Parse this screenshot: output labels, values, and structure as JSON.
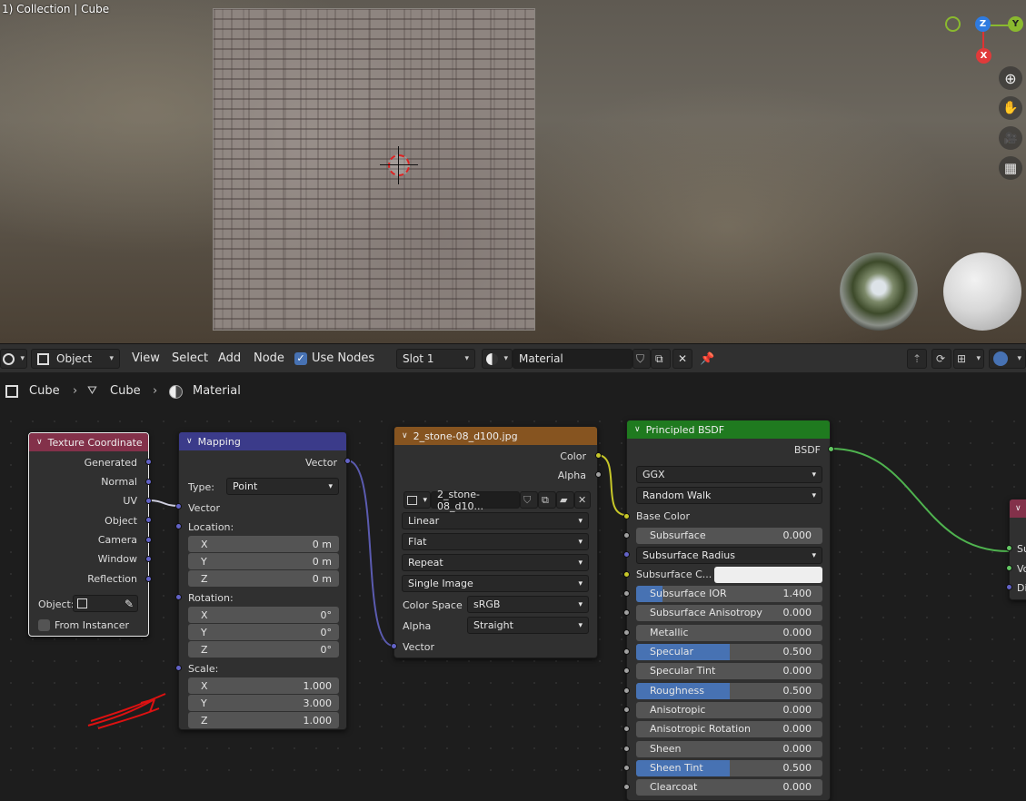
{
  "viewport": {
    "title": "1) Collection | Cube",
    "gizmo": {
      "z": "Z",
      "y": "Y",
      "x": "X"
    },
    "tools": [
      {
        "icon": "zoom-icon",
        "glyph": "⊕"
      },
      {
        "icon": "hand-pan-icon",
        "glyph": "✋"
      },
      {
        "icon": "camera-icon",
        "glyph": "🎥"
      },
      {
        "icon": "grid-perspective-icon",
        "glyph": "▦"
      }
    ]
  },
  "header": {
    "mode": "Object",
    "menus": [
      "View",
      "Select",
      "Add",
      "Node"
    ],
    "use_nodes": "Use Nodes",
    "slot": "Slot 1",
    "material": "Material"
  },
  "breadcrumb": [
    "Cube",
    "Cube",
    "Material"
  ],
  "nodes": {
    "texcoord": {
      "title": "Texture Coordinate",
      "outputs": [
        "Generated",
        "Normal",
        "UV",
        "Object",
        "Camera",
        "Window",
        "Reflection"
      ],
      "object_label": "Object:",
      "from_instancer": "From Instancer"
    },
    "mapping": {
      "title": "Mapping",
      "output": "Vector",
      "type_label": "Type:",
      "type_value": "Point",
      "input_vector": "Vector",
      "location": {
        "label": "Location:",
        "x": "0 m",
        "y": "0 m",
        "z": "0 m"
      },
      "rotation": {
        "label": "Rotation:",
        "x": "0°",
        "y": "0°",
        "z": "0°"
      },
      "scale": {
        "label": "Scale:",
        "x": "1.000",
        "y": "3.000",
        "z": "1.000"
      },
      "axis": [
        "X",
        "Y",
        "Z"
      ]
    },
    "image": {
      "title": "2_stone-08_d100.jpg",
      "outputs": [
        "Color",
        "Alpha"
      ],
      "file": "2_stone-08_d10...",
      "interpolation": "Linear",
      "projection": "Flat",
      "extension": "Repeat",
      "source": "Single Image",
      "colorspace_label": "Color Space",
      "colorspace": "sRGB",
      "alpha_label": "Alpha",
      "alpha": "Straight",
      "input": "Vector"
    },
    "bsdf": {
      "title": "Principled BSDF",
      "output": "BSDF",
      "distribution": "GGX",
      "subsurface_method": "Random Walk",
      "base_color": "Base Color",
      "subsurface_color": "Subsurface C...",
      "subsurface_radius": "Subsurface Radius",
      "sliders": [
        {
          "label": "Subsurface",
          "value": "0.000",
          "fill": 0
        },
        {
          "label": "Subsurface IOR",
          "value": "1.400",
          "fill": 0.14
        },
        {
          "label": "Subsurface Anisotropy",
          "value": "0.000",
          "fill": 0
        },
        {
          "label": "Metallic",
          "value": "0.000",
          "fill": 0
        },
        {
          "label": "Specular",
          "value": "0.500",
          "fill": 0.5
        },
        {
          "label": "Specular Tint",
          "value": "0.000",
          "fill": 0
        },
        {
          "label": "Roughness",
          "value": "0.500",
          "fill": 0.5
        },
        {
          "label": "Anisotropic",
          "value": "0.000",
          "fill": 0
        },
        {
          "label": "Anisotropic Rotation",
          "value": "0.000",
          "fill": 0
        },
        {
          "label": "Sheen",
          "value": "0.000",
          "fill": 0
        },
        {
          "label": "Sheen Tint",
          "value": "0.500",
          "fill": 0.5
        },
        {
          "label": "Clearcoat",
          "value": "0.000",
          "fill": 0
        }
      ]
    },
    "output_partial": {
      "inputs": [
        "Su",
        "Vo",
        "Di"
      ]
    }
  },
  "colors": {
    "texcoord_header": "#83314a",
    "mapping_header": "#3b3b8a",
    "image_header": "#865420",
    "bsdf_header": "#1f7a1f",
    "accent": "#4772b3"
  }
}
